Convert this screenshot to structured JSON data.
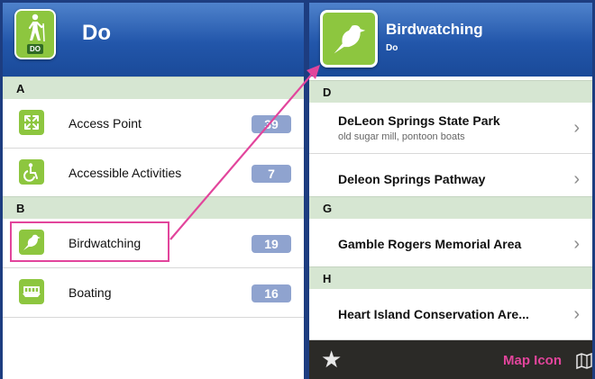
{
  "left": {
    "header": {
      "title": "Do",
      "icon_badge": "DO",
      "icon": "hiker-icon"
    },
    "sections": [
      {
        "letter": "A",
        "items": [
          {
            "label": "Access Point",
            "count": "39",
            "icon": "access-point-icon"
          },
          {
            "label": "Accessible Activities",
            "count": "7",
            "icon": "wheelchair-icon"
          }
        ]
      },
      {
        "letter": "B",
        "items": [
          {
            "label": "Birdwatching",
            "count": "19",
            "icon": "bird-icon"
          },
          {
            "label": "Boating",
            "count": "16",
            "icon": "boat-icon"
          }
        ]
      }
    ]
  },
  "right": {
    "header": {
      "title": "Birdwatching",
      "subtitle": "Do",
      "icon": "bird-icon"
    },
    "sections": [
      {
        "letter": "D",
        "items": [
          {
            "title": "DeLeon Springs State Park",
            "subtitle": "old sugar mill, pontoon boats"
          },
          {
            "title": "Deleon Springs Pathway"
          }
        ]
      },
      {
        "letter": "G",
        "items": [
          {
            "title": "Gamble Rogers Memorial Area"
          }
        ]
      },
      {
        "letter": "H",
        "items": [
          {
            "title": "Heart Island Conservation Are..."
          }
        ]
      }
    ],
    "footer": {
      "map_label": "Map Icon",
      "star_icon": "star-icon",
      "map_icon": "map-icon"
    }
  },
  "colors": {
    "background": "#1d3d80",
    "header_blue": "#2256aa",
    "icon_green": "#8dc63f",
    "section_bg": "#d6e6d2",
    "count_badge": "#8fa3cf",
    "highlight_pink": "#e2459c",
    "footer_bg": "#2b2a27"
  }
}
